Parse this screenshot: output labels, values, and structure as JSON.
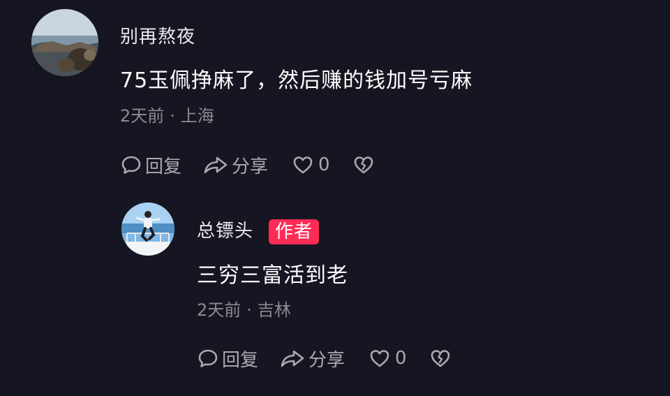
{
  "comment": {
    "username": "别再熬夜",
    "text": "75玉佩挣麻了，然后赚的钱加号亏麻",
    "time": "2天前",
    "separator": "·",
    "location": "上海",
    "reply_label": "回复",
    "share_label": "分享",
    "like_count": "0",
    "avatar_icon": "seaside-photo-avatar"
  },
  "reply": {
    "username": "总镖头",
    "badge": "作者",
    "text": "三穷三富活到老",
    "time": "2天前",
    "separator": "·",
    "location": "吉林",
    "reply_label": "回复",
    "share_label": "分享",
    "like_count": "0",
    "avatar_icon": "boat-photo-avatar"
  },
  "colors": {
    "background": "#161622",
    "badge": "#fe2c55",
    "meta_text": "#8b8b96",
    "action_text": "#a9a9b4"
  }
}
